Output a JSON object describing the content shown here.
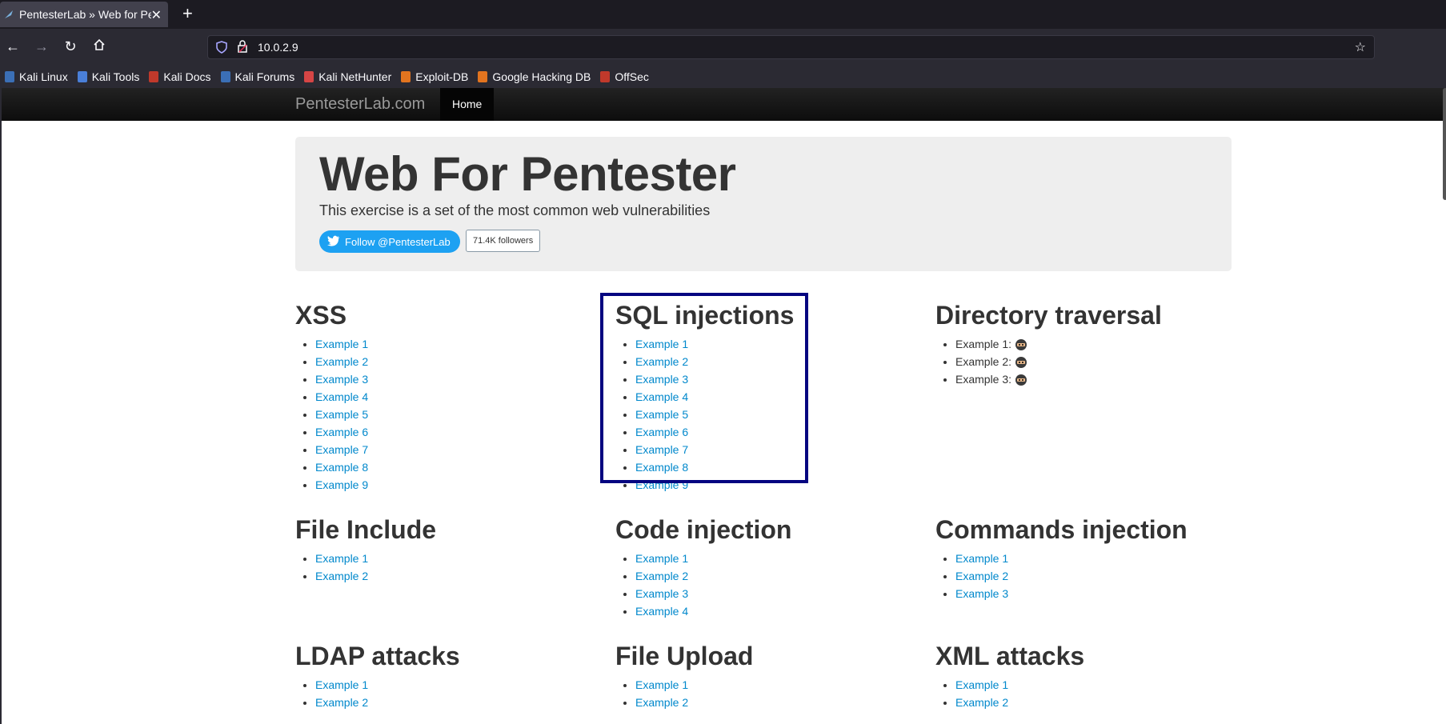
{
  "browser": {
    "tab_title": "PentesterLab » Web for Pe",
    "url": "10.0.2.9",
    "bookmarks": [
      {
        "label": "Kali Linux",
        "color": "#3b6fb6"
      },
      {
        "label": "Kali Tools",
        "color": "#4a7fd8"
      },
      {
        "label": "Kali Docs",
        "color": "#c0392b"
      },
      {
        "label": "Kali Forums",
        "color": "#3b6fb6"
      },
      {
        "label": "Kali NetHunter",
        "color": "#d64545"
      },
      {
        "label": "Exploit-DB",
        "color": "#e2741f"
      },
      {
        "label": "Google Hacking DB",
        "color": "#e2741f"
      },
      {
        "label": "OffSec",
        "color": "#c0392b"
      }
    ]
  },
  "site": {
    "brand": "PentesterLab.com",
    "nav_home": "Home",
    "hero_title": "Web For Pentester",
    "hero_text": "This exercise is a set of the most common web vulnerabilities",
    "follow_label": "Follow @PentesterLab",
    "followers": "71.4K followers"
  },
  "sections": {
    "xss": {
      "title": "XSS",
      "items": [
        "Example 1",
        "Example 2",
        "Example 3",
        "Example 4",
        "Example 5",
        "Example 6",
        "Example 7",
        "Example 8",
        "Example 9"
      ]
    },
    "sqli": {
      "title": "SQL injections",
      "items": [
        "Example 1",
        "Example 2",
        "Example 3",
        "Example 4",
        "Example 5",
        "Example 6",
        "Example 7",
        "Example 8",
        "Example 9"
      ]
    },
    "dirtrav": {
      "title": "Directory traversal",
      "items": [
        "Example 1:",
        "Example 2:",
        "Example 3:"
      ]
    },
    "fileinc": {
      "title": "File Include",
      "items": [
        "Example 1",
        "Example 2"
      ]
    },
    "codeinj": {
      "title": "Code injection",
      "items": [
        "Example 1",
        "Example 2",
        "Example 3",
        "Example 4"
      ]
    },
    "cmdinj": {
      "title": "Commands injection",
      "items": [
        "Example 1",
        "Example 2",
        "Example 3"
      ]
    },
    "ldap": {
      "title": "LDAP attacks",
      "items": [
        "Example 1",
        "Example 2"
      ]
    },
    "upload": {
      "title": "File Upload",
      "items": [
        "Example 1",
        "Example 2"
      ]
    },
    "xml": {
      "title": "XML attacks",
      "items": [
        "Example 1",
        "Example 2"
      ]
    }
  },
  "colors": {
    "link": "#0088cc",
    "highlight_border": "#050580",
    "twitter": "#1da1f2"
  }
}
